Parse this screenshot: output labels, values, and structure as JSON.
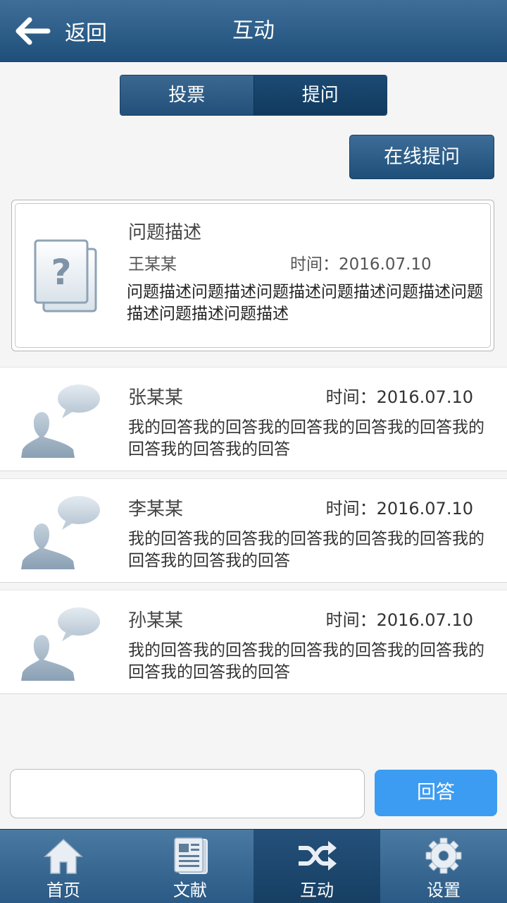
{
  "header": {
    "back_label": "返回",
    "title": "互动"
  },
  "segment": {
    "tabs": [
      "投票",
      "提问"
    ],
    "active_index": 1
  },
  "ask_button": "在线提问",
  "question": {
    "title": "问题描述",
    "user": "王某某",
    "time": "时间：2016.07.10",
    "description": "问题描述问题描述问题描述问题描述问题描述问题描述问题描述问题描述"
  },
  "answers": [
    {
      "user": "张某某",
      "time": "时间：2016.07.10",
      "text": "我的回答我的回答我的回答我的回答我的回答我的回答我的回答我的回答"
    },
    {
      "user": "李某某",
      "time": "时间：2016.07.10",
      "text": "我的回答我的回答我的回答我的回答我的回答我的回答我的回答我的回答"
    },
    {
      "user": "孙某某",
      "time": "时间：2016.07.10",
      "text": "我的回答我的回答我的回答我的回答我的回答我的回答我的回答我的回答"
    }
  ],
  "reply": {
    "input_value": "",
    "button_label": "回答"
  },
  "tabbar": {
    "items": [
      {
        "label": "首页",
        "icon": "home-icon"
      },
      {
        "label": "文献",
        "icon": "document-icon"
      },
      {
        "label": "互动",
        "icon": "shuffle-icon"
      },
      {
        "label": "设置",
        "icon": "gear-icon"
      }
    ],
    "active_index": 2
  },
  "colors": {
    "header": "#2a5a85",
    "reply_button": "#3c9cf2",
    "tab_active": "#1f4870"
  }
}
